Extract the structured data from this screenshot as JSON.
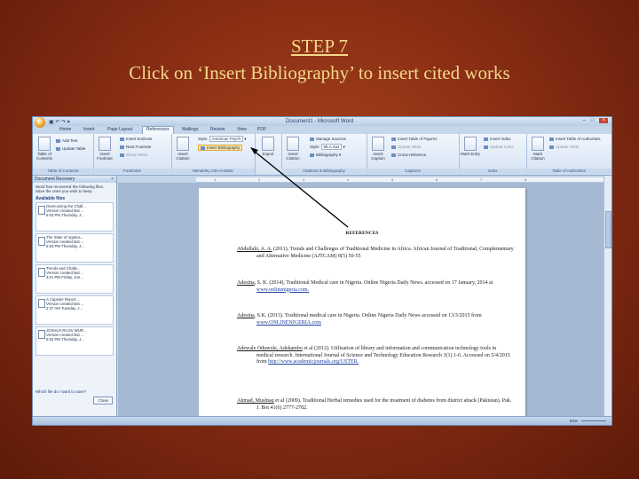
{
  "slide": {
    "step": "STEP 7",
    "instruction": "Click on ‘Insert Bibliography’ to insert cited works"
  },
  "window": {
    "title": "Document1 - Microsoft Word",
    "controls": [
      "–",
      "□",
      "×"
    ]
  },
  "tabs": [
    "Home",
    "Insert",
    "Page Layout",
    "References",
    "Mailings",
    "Review",
    "View",
    "PDF"
  ],
  "active_tab": "References",
  "ribbon": {
    "toc": {
      "label": "Table of Contents",
      "add_text": "Add Text",
      "update_table": "Update Table",
      "group": "Table of Contents"
    },
    "footnotes": {
      "insert_footnote": "Insert Footnote",
      "insert_endnote": "Insert Endnote",
      "next_footnote": "Next Footnote",
      "show_notes": "Show Notes",
      "group": "Footnotes"
    },
    "citations": {
      "insert_citation": "Insert Citation",
      "style_label": "Style:",
      "style_value": "American Psych",
      "insert_bibliography": "Insert Bibliography",
      "group": "Mendeley Cite-O-Matic"
    },
    "export": {
      "label": "Export"
    },
    "citations2": {
      "insert_citation": "Insert Citation",
      "manage_sources": "Manage Sources",
      "style_label": "Style:",
      "style_value": "MLA Sixt",
      "bibliography": "Bibliography",
      "group": "Citations & Bibliography"
    },
    "captions": {
      "insert_caption": "Insert Caption",
      "insert_table_of_figures": "Insert Table of Figures",
      "update_table": "Update Table",
      "cross_reference": "Cross-reference",
      "group": "Captions"
    },
    "index": {
      "mark_entry": "Mark Entry",
      "insert_index": "Insert Index",
      "update_index": "Update Index",
      "group": "Index"
    },
    "authorities": {
      "mark_citation": "Mark Citation",
      "insert_toa": "Insert Table of Authorities",
      "update_table": "Update Table",
      "group": "Table of Authorities"
    }
  },
  "recovery_pane": {
    "title": "Document Recovery",
    "message": "Word has recovered the following files. Save the ones you wish to keep.",
    "available_files": "Available files",
    "files": [
      {
        "name": "Overcoming the Chall...",
        "status": "Version created last ...",
        "time": "5:53 PM Thursday, J..."
      },
      {
        "name": "The State of Applica...",
        "status": "Version created last ...",
        "time": "5:53 PM Thursday, J..."
      },
      {
        "name": "Trends and Challe...",
        "status": "Version created last ...",
        "time": "3:01 PM Friday, Jun..."
      },
      {
        "name": "A Capsule Report ...",
        "status": "Version created last ...",
        "time": "2:37 AM Tuesday, J..."
      },
      {
        "name": "JOSHUA RAJIV WUR...",
        "status": "Version created last ...",
        "time": "5:53 PM Thursday, J..."
      }
    ],
    "which_to_save": "Which file do I want to save?",
    "close": "Close"
  },
  "document": {
    "heading": "REFERENCES",
    "references": [
      {
        "author": "Abdullahi, A. A.",
        "text": " (2011). Trends and Challenges of Traditional Medicine in Africa. African Journal of Traditional, Complementary and Alternative Medicine (AJTCAM) 8(5) 50-55",
        "link": ""
      },
      {
        "author": "Adesina",
        "text": ", S. K. (2014), Traditional Medical care in Nigeria. Online Nigeria Daily News. accessed on 17 January, 2014 at ",
        "link": "www.onlinenigeria.com."
      },
      {
        "author": "Adesina",
        "text": ", S.K. (2013). Traditional medical care in Nigeria. Online Nigeria Daily News accessed on 13/3/2015 from ",
        "link": "www.ONLINENIGERIA.com"
      },
      {
        "author": "Adewale Oduwole, Adekambo",
        "text": " et al (2012). Utilization of library and information and communication technology tools in medical research. International Journal of Science and Technology Education Research 3(1) 1-6. Accessed on 5/4/2015 from ",
        "link": "http://www.academicjournals.org/USTER."
      },
      {
        "author": "Ahmad, Mushtaq",
        "text": " et al (2009). Traditional Herbal remedies used for the treatment of diabetes from district attack (Pakistan). Pak. J. Bot 41(6) 2777-2782.",
        "link": ""
      }
    ]
  },
  "status": {
    "zoom": "94%"
  },
  "colors": {
    "slide_bg": "#8a2e14",
    "title_text": "#f3d98a",
    "arrow": "#000000"
  }
}
